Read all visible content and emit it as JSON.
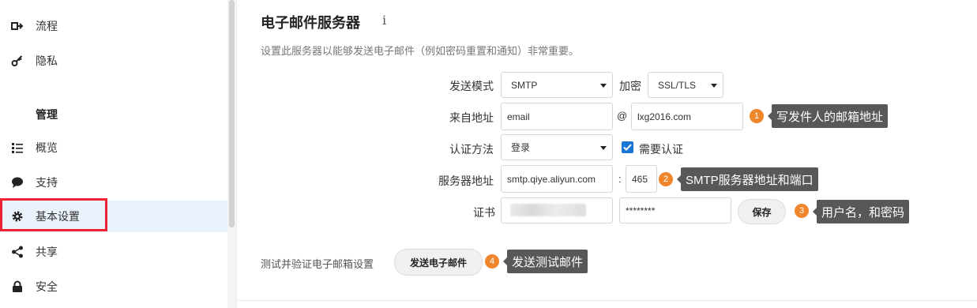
{
  "sidebar": {
    "items": [
      {
        "label": "流程",
        "icon": "flow-icon"
      },
      {
        "label": "隐私",
        "icon": "key-icon"
      },
      {
        "label": "管理",
        "section": true
      },
      {
        "label": "概览",
        "icon": "list-icon"
      },
      {
        "label": "支持",
        "icon": "chat-icon"
      },
      {
        "label": "基本设置",
        "icon": "gear-icon",
        "active": true
      },
      {
        "label": "共享",
        "icon": "share-icon"
      },
      {
        "label": "安全",
        "icon": "lock-icon"
      }
    ]
  },
  "email": {
    "title": "电子邮件服务器",
    "info_icon": "i",
    "description": "设置此服务器以能够发送电子邮件（例如密码重置和通知）非常重要。",
    "send_mode_label": "发送模式",
    "send_mode_value": "SMTP",
    "encryption_label": "加密",
    "encryption_value": "SSL/TLS",
    "from_label": "来自地址",
    "from_user": "email",
    "at": "@",
    "from_domain": "lxg2016.com",
    "auth_label": "认证方法",
    "auth_value": "登录",
    "require_auth_label": "需要认证",
    "server_label": "服务器地址",
    "server_value": "smtp.qiye.aliyun.com",
    "colon": ":",
    "port_value": "465",
    "cert_label": "证书",
    "password_value": "********",
    "save_label": "保存",
    "test_label": "测试并验证电子邮箱设置",
    "send_test_label": "发送电子邮件"
  },
  "annotations": [
    {
      "num": "1",
      "text": "写发件人的邮箱地址"
    },
    {
      "num": "2",
      "text": "SMTP服务器地址和端口"
    },
    {
      "num": "3",
      "text": "用户名，和密码"
    },
    {
      "num": "4",
      "text": "发送测试邮件"
    }
  ],
  "colors": {
    "accent": "#1976d2",
    "badge": "#f0862c",
    "tooltip": "#585858",
    "highlight": "#ee2233",
    "active_bg": "#eaf3fb"
  }
}
